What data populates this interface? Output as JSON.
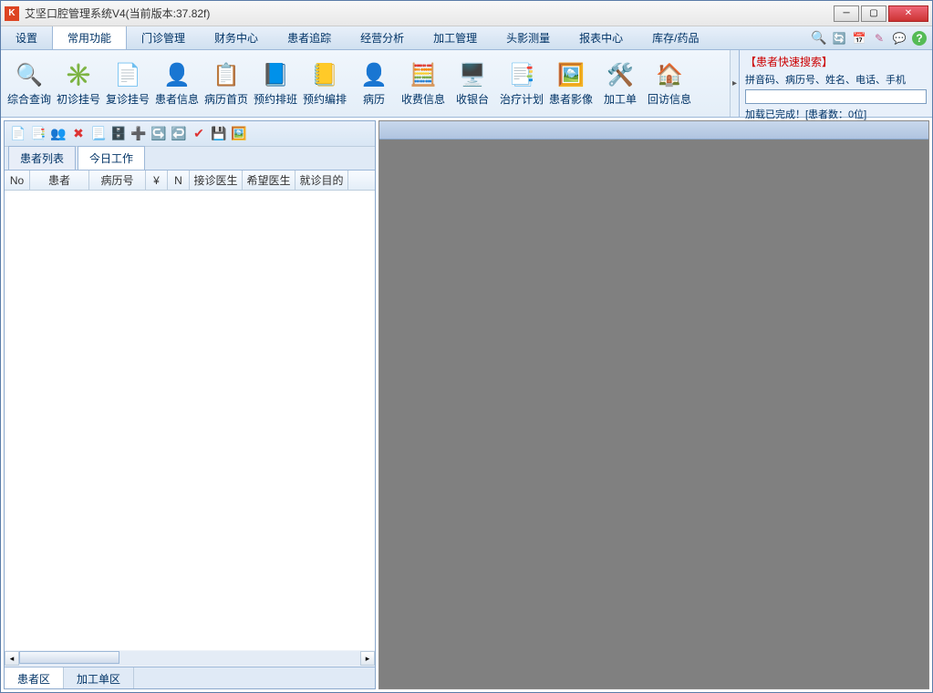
{
  "titlebar": {
    "title": "艾坚口腔管理系统V4(当前版本:37.82f)"
  },
  "menu": {
    "items": [
      "设置",
      "常用功能",
      "门诊管理",
      "财务中心",
      "患者追踪",
      "经营分析",
      "加工管理",
      "头影测量",
      "报表中心",
      "库存/药品"
    ],
    "active_index": 1
  },
  "ribbon": {
    "buttons": [
      {
        "label": "综合查询",
        "icon": "search-icon"
      },
      {
        "label": "初诊挂号",
        "icon": "new-register-icon"
      },
      {
        "label": "复诊挂号",
        "icon": "revisit-register-icon"
      },
      {
        "label": "患者信息",
        "icon": "patient-info-icon"
      },
      {
        "label": "病历首页",
        "icon": "record-home-icon"
      },
      {
        "label": "预约排班",
        "icon": "appointment-schedule-icon"
      },
      {
        "label": "预约编排",
        "icon": "appointment-arrange-icon"
      },
      {
        "label": "病历",
        "icon": "medical-record-icon"
      },
      {
        "label": "收费信息",
        "icon": "fee-info-icon"
      },
      {
        "label": "收银台",
        "icon": "cashier-icon"
      },
      {
        "label": "治疗计划",
        "icon": "treatment-plan-icon"
      },
      {
        "label": "患者影像",
        "icon": "patient-image-icon"
      },
      {
        "label": "加工单",
        "icon": "work-order-icon"
      },
      {
        "label": "回访信息",
        "icon": "followup-icon"
      }
    ]
  },
  "search_pane": {
    "title": "【患者快速搜索】",
    "hint": "拼音码、病历号、姓名、电话、手机",
    "value": "",
    "status": "加载已完成！[患者数：0位]"
  },
  "left_pane": {
    "top_tabs": [
      "患者列表",
      "今日工作"
    ],
    "top_active_index": 1,
    "columns": [
      "No",
      "患者",
      "病历号",
      "¥",
      "N",
      "接诊医生",
      "希望医生",
      "就诊目的"
    ],
    "bottom_tabs": [
      "患者区",
      "加工单区"
    ],
    "bottom_active_index": 0
  }
}
